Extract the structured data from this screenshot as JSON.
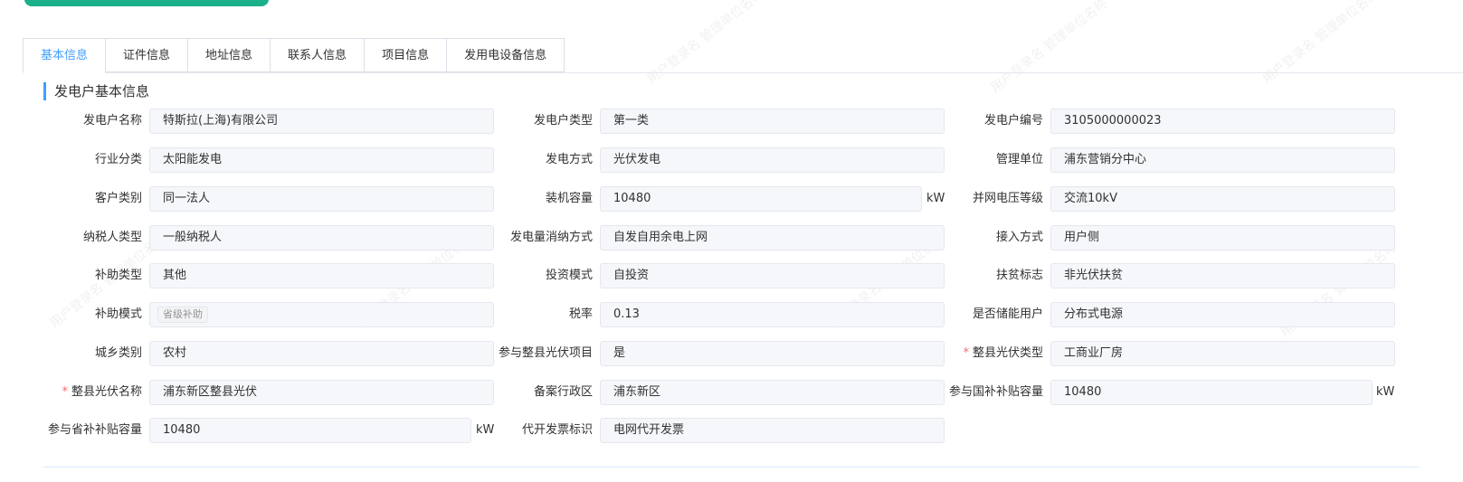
{
  "tabs": [
    "基本信息",
    "证件信息",
    "地址信息",
    "联系人信息",
    "项目信息",
    "发用电设备信息"
  ],
  "section_title": "发电户基本信息",
  "fields": {
    "name": {
      "label": "发电户名称",
      "value": "特斯拉(上海)有限公司"
    },
    "type": {
      "label": "发电户类型",
      "value": "第一类"
    },
    "number": {
      "label": "发电户编号",
      "value": "3105000000023"
    },
    "industry": {
      "label": "行业分类",
      "value": "太阳能发电"
    },
    "gen_method": {
      "label": "发电方式",
      "value": "光伏发电"
    },
    "mgmt_unit": {
      "label": "管理单位",
      "value": "浦东营销分中心"
    },
    "customer_cat": {
      "label": "客户类别",
      "value": "同一法人"
    },
    "capacity": {
      "label": "装机容量",
      "value": "10480",
      "unit": "kW"
    },
    "voltage": {
      "label": "并网电压等级",
      "value": "交流10kV"
    },
    "taxpayer": {
      "label": "纳税人类型",
      "value": "一般纳税人"
    },
    "consumption": {
      "label": "发电量消纳方式",
      "value": "自发自用余电上网"
    },
    "access": {
      "label": "接入方式",
      "value": "用户侧"
    },
    "subsidy_type": {
      "label": "补助类型",
      "value": "其他"
    },
    "invest": {
      "label": "投资模式",
      "value": "自投资"
    },
    "poverty": {
      "label": "扶贫标志",
      "value": "非光伏扶贫"
    },
    "subsidy_mode": {
      "label": "补助模式",
      "tag": "省级补助"
    },
    "tax_rate": {
      "label": "税率",
      "value": "0.13"
    },
    "storage": {
      "label": "是否储能用户",
      "value": "分布式电源"
    },
    "urban_rural": {
      "label": "城乡类别",
      "value": "农村"
    },
    "county_pv": {
      "label": "参与整县光伏项目",
      "value": "是"
    },
    "county_pv_type": {
      "label": "整县光伏类型",
      "value": "工商业厂房"
    },
    "county_pv_name": {
      "label": "整县光伏名称",
      "value": "浦东新区整县光伏"
    },
    "filing_region": {
      "label": "备案行政区",
      "value": "浦东新区"
    },
    "national_subsidy_cap": {
      "label": "参与国补补贴容量",
      "value": "10480",
      "unit": "kW"
    },
    "provincial_subsidy_cap": {
      "label": "参与省补补贴容量",
      "value": "10480",
      "unit": "kW"
    },
    "invoice": {
      "label": "代开发票标识",
      "value": "电网代开发票"
    }
  }
}
